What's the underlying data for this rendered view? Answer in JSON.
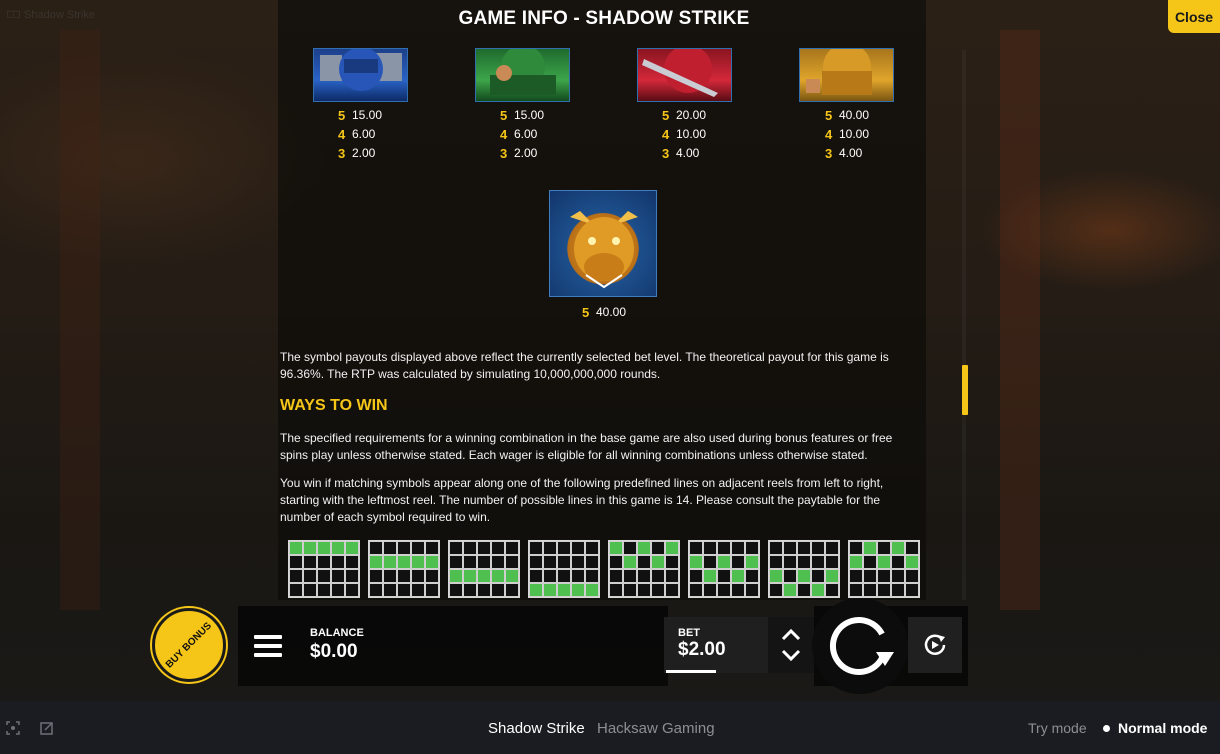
{
  "window": {
    "corner_title": "🀱 Shadow Strike"
  },
  "header": {
    "title": "GAME INFO - SHADOW STRIKE",
    "close_label": "Close"
  },
  "paytable": [
    {
      "icon": "blue-ninja-symbol",
      "pays": [
        {
          "count": "5",
          "value": "15.00"
        },
        {
          "count": "4",
          "value": "6.00"
        },
        {
          "count": "3",
          "value": "2.00"
        }
      ]
    },
    {
      "icon": "green-ninja-symbol",
      "pays": [
        {
          "count": "5",
          "value": "15.00"
        },
        {
          "count": "4",
          "value": "6.00"
        },
        {
          "count": "3",
          "value": "2.00"
        }
      ]
    },
    {
      "icon": "red-ninja-symbol",
      "pays": [
        {
          "count": "5",
          "value": "20.00"
        },
        {
          "count": "4",
          "value": "10.00"
        },
        {
          "count": "3",
          "value": "4.00"
        }
      ]
    },
    {
      "icon": "gold-ninja-symbol",
      "pays": [
        {
          "count": "5",
          "value": "40.00"
        },
        {
          "count": "4",
          "value": "10.00"
        },
        {
          "count": "3",
          "value": "4.00"
        }
      ]
    },
    {
      "icon": "dragon-symbol",
      "pays": [
        {
          "count": "5",
          "value": "40.00"
        }
      ]
    }
  ],
  "rtp_text": "The symbol payouts displayed above reflect the currently selected bet level. The theoretical payout for this game is 96.36%. The RTP was calculated by simulating 10,000,000,000 rounds.",
  "ways_to_win": {
    "heading": "WAYS TO WIN",
    "para1": "The specified requirements for a winning combination in the base game are also used during bonus features or free spins play unless otherwise stated. Each wager is eligible for all winning combinations unless otherwise stated.",
    "para2": "You win if matching symbols appear along one of the following predefined lines on adjacent reels from left to right, starting with the leftmost reel. The number of possible lines in this game is 14. Please consult the paytable for the number of each symbol required to win."
  },
  "paylines": [
    [
      0,
      0,
      0,
      0,
      0
    ],
    [
      1,
      1,
      1,
      1,
      1
    ],
    [
      2,
      2,
      2,
      2,
      2
    ],
    [
      3,
      3,
      3,
      3,
      3
    ],
    [
      0,
      1,
      0,
      1,
      0
    ],
    [
      1,
      2,
      1,
      2,
      1
    ],
    [
      2,
      3,
      2,
      3,
      2
    ],
    [
      1,
      0,
      1,
      0,
      1
    ]
  ],
  "controls": {
    "buy_bonus_label": "BUY BONUS",
    "balance_label": "BALANCE",
    "balance_value": "$0.00",
    "bet_label": "BET",
    "bet_value": "$2.00"
  },
  "footer": {
    "game_name": "Shadow Strike",
    "studio": "Hacksaw Gaming",
    "try_mode": "Try mode",
    "normal_mode": "Normal mode"
  },
  "colors": {
    "accent": "#f5c518",
    "win_cell": "#4fbf4f",
    "footer_bg": "#1b1c21"
  }
}
